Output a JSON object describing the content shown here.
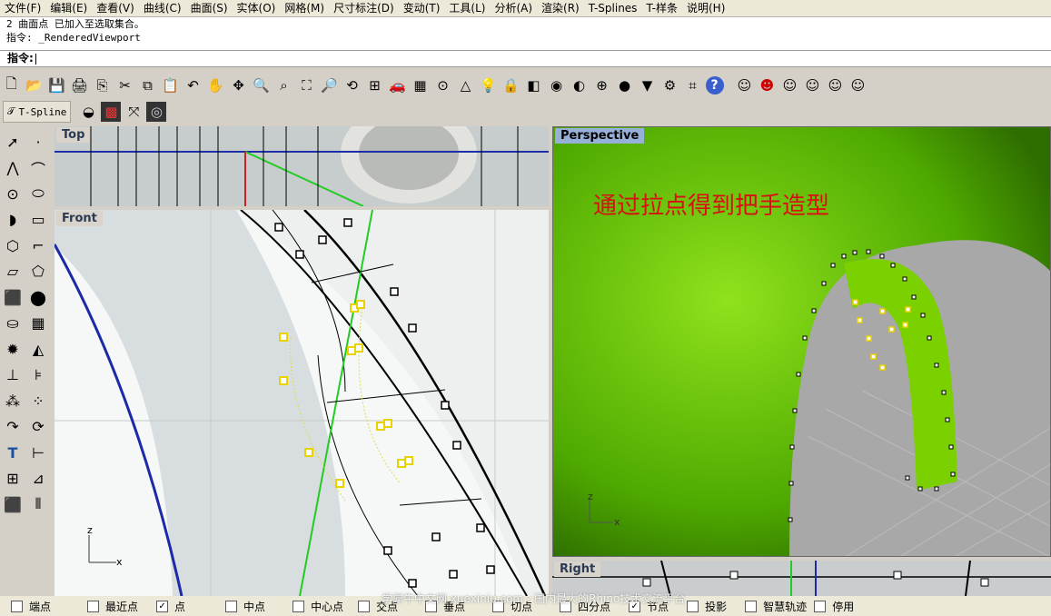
{
  "menu": [
    "文件(F)",
    "编辑(E)",
    "查看(V)",
    "曲线(C)",
    "曲面(S)",
    "实体(O)",
    "网格(M)",
    "尺寸标注(D)",
    "变动(T)",
    "工具(L)",
    "分析(A)",
    "渲染(R)",
    "T-Splines",
    "T-样条",
    "说明(H)"
  ],
  "command_history": [
    "2 曲面点 已加入至选取集合。",
    "指令: _RenderedViewport"
  ],
  "command_prompt": "指令:",
  "tspline_label": "T-Spline",
  "viewports": {
    "top": "Top",
    "front": "Front",
    "perspective": "Perspective",
    "right": "Right"
  },
  "annotation": "通过拉点得到把手造型",
  "axes": {
    "z": "z",
    "x": "x"
  },
  "osnaps": [
    {
      "label": "端点",
      "checked": false
    },
    {
      "label": "最近点",
      "checked": false
    },
    {
      "label": "点",
      "checked": true
    },
    {
      "label": "中点",
      "checked": false
    },
    {
      "label": "中心点",
      "checked": false
    },
    {
      "label": "交点",
      "checked": false
    },
    {
      "label": "垂点",
      "checked": false
    },
    {
      "label": "切点",
      "checked": false
    },
    {
      "label": "四分点",
      "checked": false
    },
    {
      "label": "节点",
      "checked": true
    },
    {
      "label": "投影",
      "checked": false
    },
    {
      "label": "智慧轨迹",
      "checked": false
    },
    {
      "label": "停用",
      "checked": false
    }
  ],
  "watermark": "学犀牛中文网 xuexiniu.com - 国内最大的Rhino技术交流平台",
  "check_mark": "✓",
  "colors": {
    "accent": "#96b0d7",
    "handle": "#5cb800",
    "annotation": "#d81010"
  }
}
